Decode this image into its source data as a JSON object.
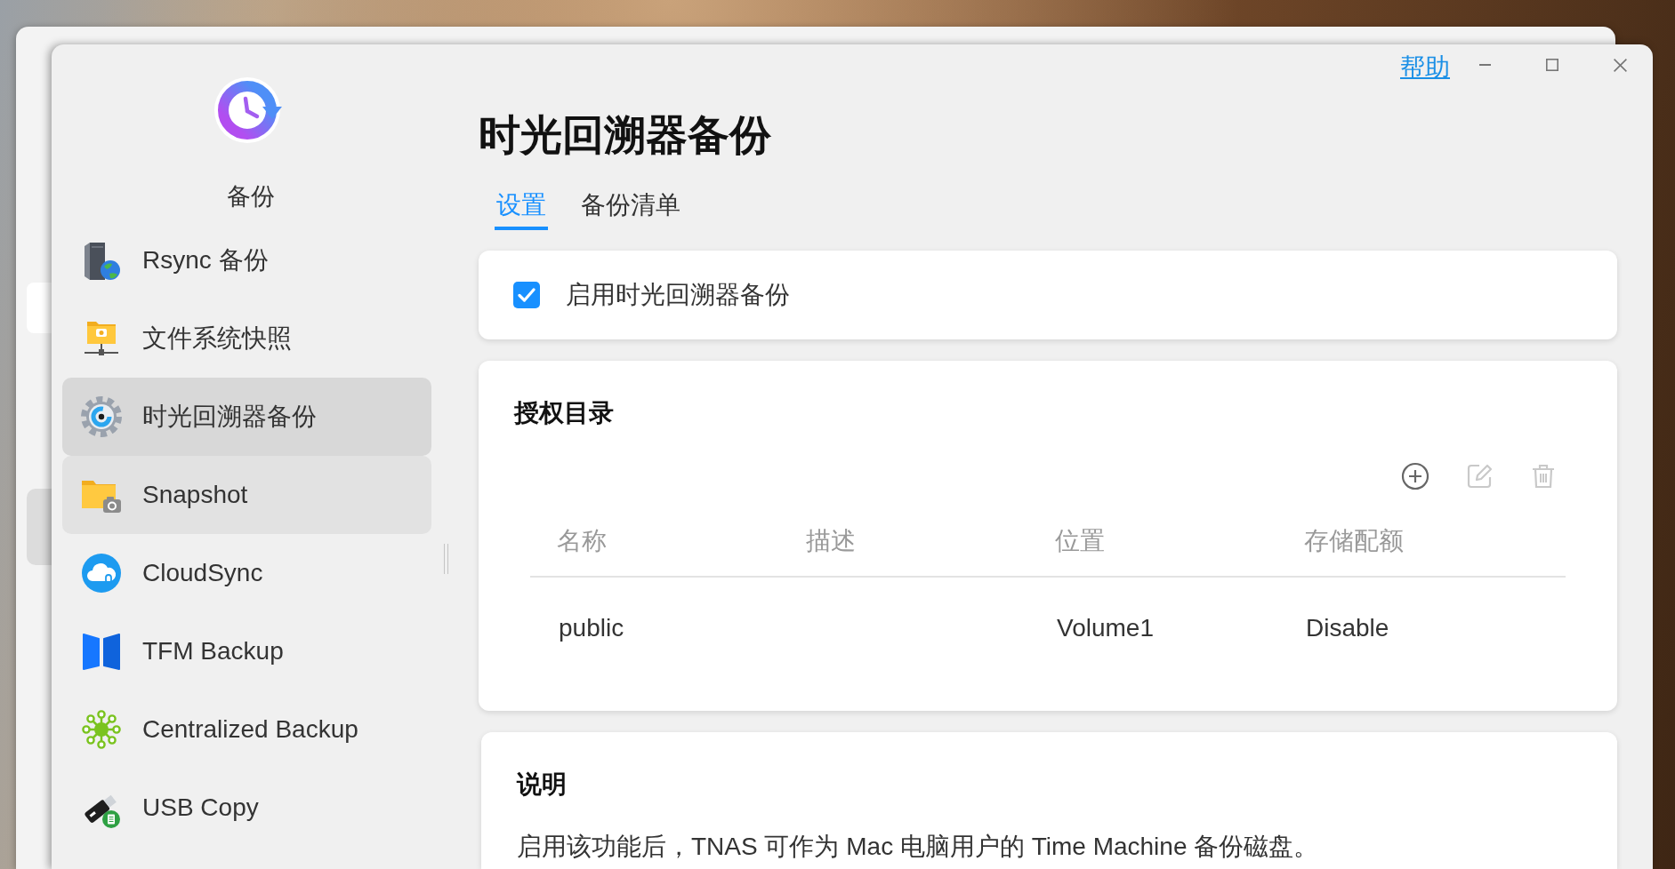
{
  "window": {
    "app_name": "备份",
    "help_link": "帮助"
  },
  "sidebar": {
    "items": [
      {
        "kind": "rsync",
        "label": "Rsync 备份",
        "selected": false,
        "hovered": false
      },
      {
        "kind": "fssnapshot",
        "label": "文件系统快照",
        "selected": false,
        "hovered": false
      },
      {
        "kind": "timemachine",
        "label": "时光回溯器备份",
        "selected": true,
        "hovered": false
      },
      {
        "kind": "snapshot",
        "label": "Snapshot",
        "selected": false,
        "hovered": true
      },
      {
        "kind": "cloudsync",
        "label": "CloudSync",
        "selected": false,
        "hovered": false
      },
      {
        "kind": "tfm",
        "label": "TFM Backup",
        "selected": false,
        "hovered": false
      },
      {
        "kind": "centralized",
        "label": "Centralized Backup",
        "selected": false,
        "hovered": false
      },
      {
        "kind": "usbcopy",
        "label": "USB Copy",
        "selected": false,
        "hovered": false
      }
    ]
  },
  "page": {
    "title": "时光回溯器备份",
    "tabs": [
      {
        "label": "设置",
        "selected": true
      },
      {
        "label": "备份清单",
        "selected": false
      }
    ]
  },
  "enable_card": {
    "label": "启用时光回溯器备份",
    "checked": true
  },
  "authorized_directories": {
    "title": "授权目录",
    "toolbar": [
      {
        "kind": "add",
        "disabled": false
      },
      {
        "kind": "edit",
        "disabled": true
      },
      {
        "kind": "delete",
        "disabled": true
      }
    ],
    "table": {
      "columns": [
        "名称",
        "描述",
        "位置",
        "存储配额"
      ],
      "rows": [
        {
          "name": "public",
          "location": "Volume1",
          "quota": "Disable"
        }
      ]
    }
  },
  "description": {
    "title": "说明",
    "text": "启用该功能后，TNAS 可作为 Mac 电脑用户的 Time Machine 备份磁盘。"
  }
}
